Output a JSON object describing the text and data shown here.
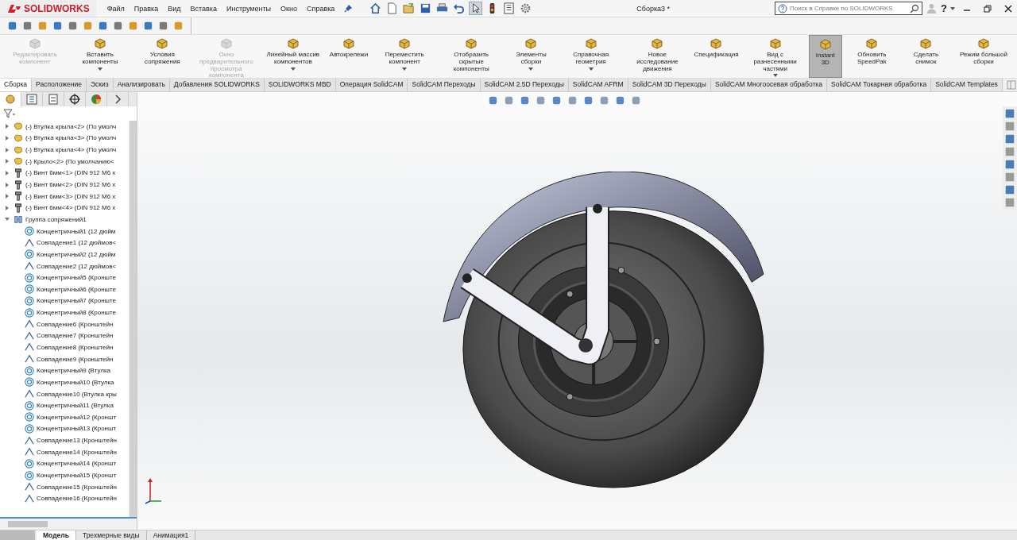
{
  "app": {
    "logo": "SOLIDWORKS"
  },
  "menu": [
    "Файл",
    "Правка",
    "Вид",
    "Вставка",
    "Инструменты",
    "Окно",
    "Справка"
  ],
  "window": {
    "title": "Сборка3 *"
  },
  "search": {
    "placeholder": "Поиск в Справке по SOLIDWORKS"
  },
  "help_glyph": "?",
  "ribbon": {
    "buttons": [
      {
        "label": "Редактировать компонент",
        "disabled": true,
        "dropdown": false,
        "selected": false
      },
      {
        "label": "Вставить компоненты",
        "disabled": false,
        "dropdown": true,
        "selected": false
      },
      {
        "label": "Условия сопряжения",
        "disabled": false,
        "dropdown": false,
        "selected": false
      },
      {
        "label": "Окно предварительного просмотра компонента",
        "disabled": true,
        "dropdown": false,
        "selected": false
      },
      {
        "label": "Линейный массив компонентов",
        "disabled": false,
        "dropdown": true,
        "selected": false
      },
      {
        "label": "Автокрепежи",
        "disabled": false,
        "dropdown": false,
        "selected": false
      },
      {
        "label": "Переместить компонент",
        "disabled": false,
        "dropdown": true,
        "selected": false
      },
      {
        "label": "Отобразить скрытые компоненты",
        "disabled": false,
        "dropdown": false,
        "selected": false
      },
      {
        "label": "Элементы сборки",
        "disabled": false,
        "dropdown": true,
        "selected": false
      },
      {
        "label": "Справочная геометрия",
        "disabled": false,
        "dropdown": true,
        "selected": false
      },
      {
        "label": "Новое исследование движения",
        "disabled": false,
        "dropdown": false,
        "selected": false
      },
      {
        "label": "Спецификация",
        "disabled": false,
        "dropdown": false,
        "selected": false
      },
      {
        "label": "Вид с разнесенными частями",
        "disabled": false,
        "dropdown": true,
        "selected": false
      },
      {
        "label": "Instant 3D",
        "disabled": false,
        "dropdown": false,
        "selected": true
      },
      {
        "label": "Обновить SpeedPak",
        "disabled": false,
        "dropdown": false,
        "selected": false
      },
      {
        "label": "Сделать снимок",
        "disabled": false,
        "dropdown": false,
        "selected": false
      },
      {
        "label": "Режим большой сборки",
        "disabled": false,
        "dropdown": false,
        "selected": false
      }
    ]
  },
  "command_tabs": [
    {
      "label": "Сборка",
      "selected": true
    },
    {
      "label": "Расположение",
      "selected": false
    },
    {
      "label": "Эскиз",
      "selected": false
    },
    {
      "label": "Анализировать",
      "selected": false
    },
    {
      "label": "Добавления SOLIDWORKS",
      "selected": false
    },
    {
      "label": "SOLIDWORKS MBD",
      "selected": false
    },
    {
      "label": "Операция  SolidCAM",
      "selected": false
    },
    {
      "label": "SolidCAM Переходы",
      "selected": false
    },
    {
      "label": "SolidCAM 2.5D Переходы",
      "selected": false
    },
    {
      "label": "SolidCAM AFRM",
      "selected": false
    },
    {
      "label": "SolidCAM 3D Переходы",
      "selected": false
    },
    {
      "label": "SolidCAM Многоосевая обработка",
      "selected": false
    },
    {
      "label": "SolidCAM Токарная обработка",
      "selected": false
    },
    {
      "label": "SolidCAM Templates",
      "selected": false
    }
  ],
  "tree": {
    "items": [
      {
        "kind": "component",
        "label": "(-) Втулка крыла<2> (По умолч",
        "expanded": false
      },
      {
        "kind": "component",
        "label": "(-) Втулка крыла<3> (По умолч",
        "expanded": false
      },
      {
        "kind": "component",
        "label": "(-) Втулка крыла<4> (По умолч",
        "expanded": false
      },
      {
        "kind": "component",
        "label": "(-) Крыло<2> (По умолчанию<",
        "expanded": false
      },
      {
        "kind": "screw",
        "label": "(-) Винт 6мм<1> (DIN 912 M6 x",
        "expanded": false
      },
      {
        "kind": "screw",
        "label": "(-) Винт 6мм<2> (DIN 912 M6 x",
        "expanded": false
      },
      {
        "kind": "screw",
        "label": "(-) Винт 6мм<3> (DIN 912 M6 x",
        "expanded": false
      },
      {
        "kind": "screw",
        "label": "(-) Винт 6мм<4> (DIN 912 M6 x",
        "expanded": false
      },
      {
        "kind": "group",
        "label": "Группа сопряжений1",
        "expanded": true,
        "children": [
          {
            "kind": "concentric",
            "label": "Концентричный1 (12 дюйм"
          },
          {
            "kind": "coincident",
            "label": "Совпадение1 (12 дюймов<"
          },
          {
            "kind": "concentric",
            "label": "Концентричный2 (12 дюйм"
          },
          {
            "kind": "coincident",
            "label": "Совпадение2 (12 дюймов<"
          },
          {
            "kind": "concentric",
            "label": "Концентричный5 (Кронште"
          },
          {
            "kind": "concentric",
            "label": "Концентричный6 (Кронште"
          },
          {
            "kind": "concentric",
            "label": "Концентричный7 (Кронште"
          },
          {
            "kind": "concentric",
            "label": "Концентричный8 (Кронште"
          },
          {
            "kind": "coincident",
            "label": "Совпадение6 (Кронштейн"
          },
          {
            "kind": "coincident",
            "label": "Совпадение7 (Кронштейн"
          },
          {
            "kind": "coincident",
            "label": "Совпадение8 (Кронштейн"
          },
          {
            "kind": "coincident",
            "label": "Совпадение9 (Кронштейн"
          },
          {
            "kind": "concentric",
            "label": "Концентричный9 (Втулка"
          },
          {
            "kind": "concentric",
            "label": "Концентричный10 (Втулка"
          },
          {
            "kind": "coincident",
            "label": "Совпадение10 (Втулка кры"
          },
          {
            "kind": "concentric",
            "label": "Концентричный11 (Втулка"
          },
          {
            "kind": "concentric",
            "label": "Концентричный12 (Кроншт"
          },
          {
            "kind": "concentric",
            "label": "Концентричный13 (Кроншт"
          },
          {
            "kind": "coincident",
            "label": "Совпадение13 (Кронштейн"
          },
          {
            "kind": "coincident",
            "label": "Совпадение14 (Кронштейн"
          },
          {
            "kind": "concentric",
            "label": "Концентричный14 (Кроншт"
          },
          {
            "kind": "concentric",
            "label": "Концентричный15 (Кроншт"
          },
          {
            "kind": "coincident",
            "label": "Совпадение15 (Кронштейн"
          },
          {
            "kind": "coincident",
            "label": "Совпадение16 (Кронштейн"
          }
        ]
      }
    ]
  },
  "bottom_tabs": [
    {
      "label": "Модель",
      "selected": true
    },
    {
      "label": "Трехмерные виды",
      "selected": false
    },
    {
      "label": "Анимация1",
      "selected": false
    }
  ]
}
